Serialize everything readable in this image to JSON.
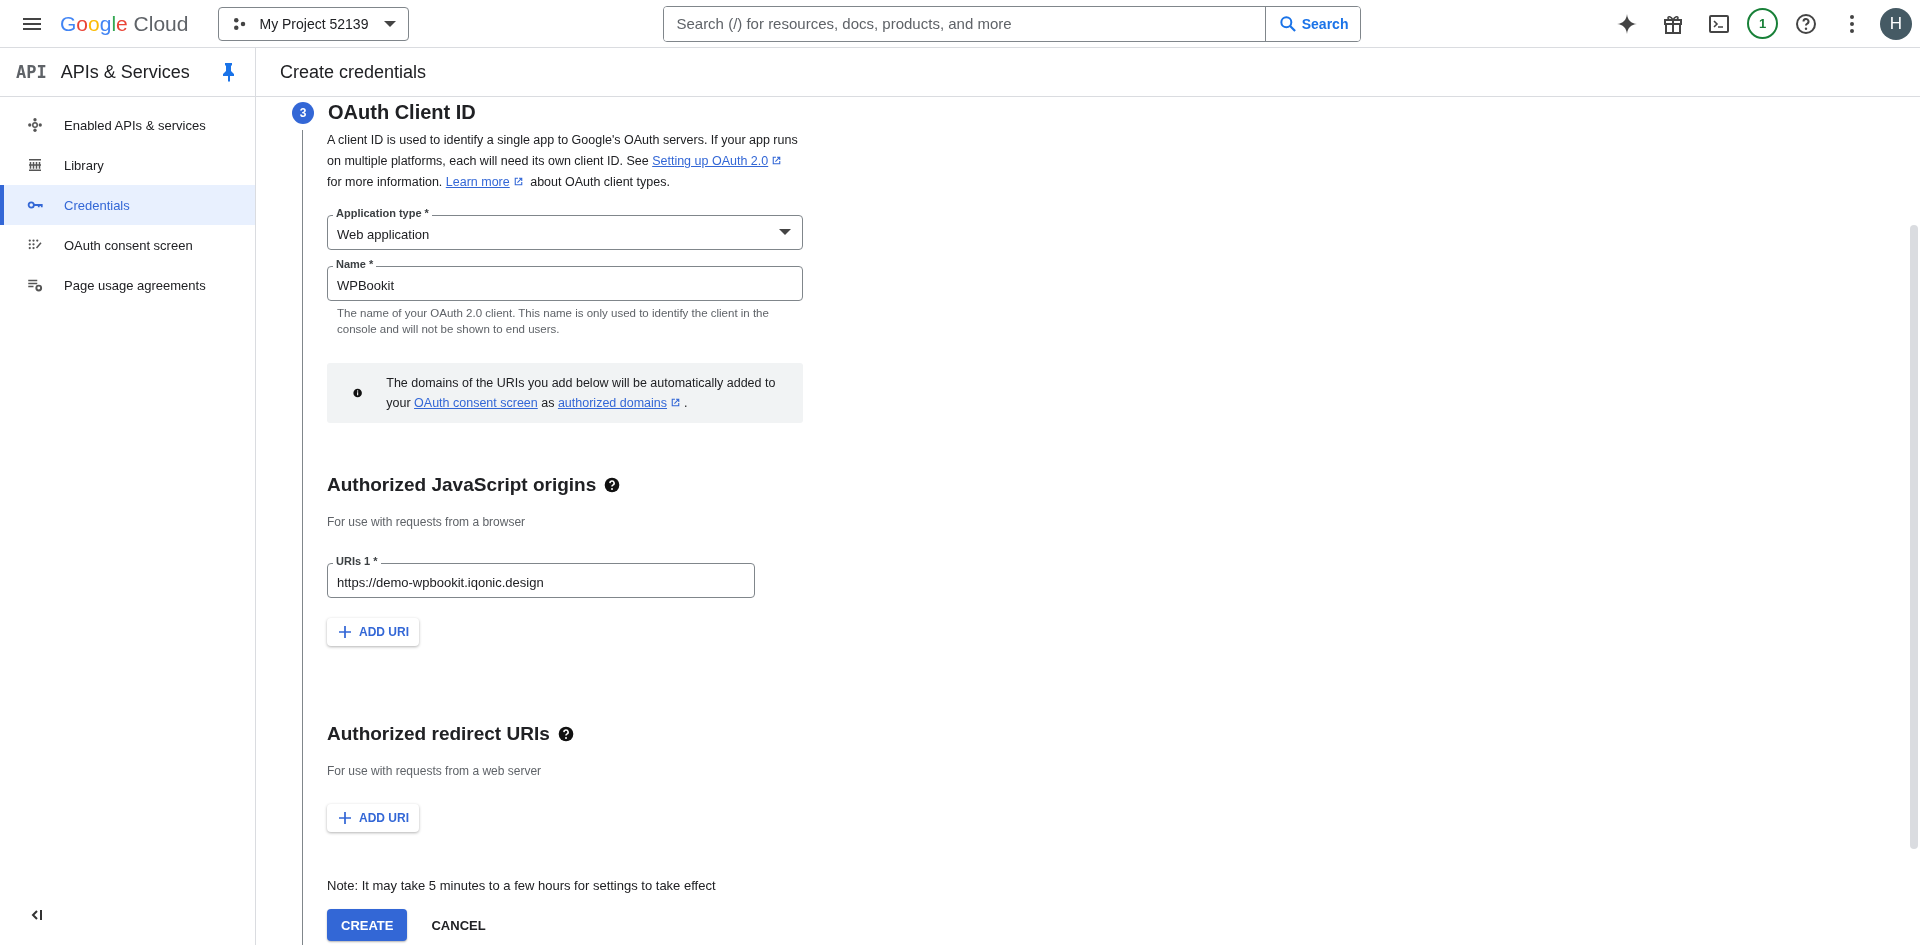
{
  "topbar": {
    "logo": "Google Cloud",
    "project": "My Project 52139",
    "search": {
      "placeholder": "Search (/) for resources, docs, products, and more",
      "button": "Search"
    },
    "notifications": "1",
    "avatar": "H"
  },
  "sidebar": {
    "badge": "API",
    "title": "APIs & Services",
    "pinned": true,
    "items": [
      {
        "label": "Enabled APIs & services",
        "selected": false
      },
      {
        "label": "Library",
        "selected": false
      },
      {
        "label": "Credentials",
        "selected": true
      },
      {
        "label": "OAuth consent screen",
        "selected": false
      },
      {
        "label": "Page usage agreements",
        "selected": false
      }
    ]
  },
  "page": {
    "title": "Create credentials"
  },
  "step": {
    "number": "3",
    "title": "OAuth Client ID",
    "description": [
      {
        "kind": "text",
        "text": "A client ID is used to identify a single app to Google's OAuth servers. If your app runs on multiple platforms, each will need its own client ID. See "
      },
      {
        "kind": "external_link",
        "text": "Setting up OAuth 2.0"
      },
      {
        "kind": "text",
        "text": " for more information. "
      },
      {
        "kind": "external_link",
        "text": "Learn more"
      },
      {
        "kind": "text",
        "text": " about OAuth client types."
      }
    ],
    "fields": [
      {
        "kind": "select",
        "label": "Application type *",
        "value": "Web application"
      },
      {
        "kind": "text",
        "label": "Name *",
        "value": "WPBookit",
        "helper": "The name of your OAuth 2.0 client. This name is only used to identify the client in the console and will not be shown to end users."
      }
    ],
    "info": [
      {
        "kind": "text",
        "text": "The domains of the URIs you add below will be automatically added to your "
      },
      {
        "kind": "link",
        "text": "OAuth consent screen"
      },
      {
        "kind": "text",
        "text": " as "
      },
      {
        "kind": "external_link",
        "text": "authorized domains"
      },
      {
        "kind": "text",
        "text": "."
      }
    ],
    "sections": [
      {
        "title": "Authorized JavaScript origins",
        "subtitle": "For use with requests from a browser",
        "uris": [
          {
            "label": "URIs 1 *",
            "value": "https://demo-wpbookit.iqonic.design"
          }
        ],
        "add_button": "ADD URI"
      },
      {
        "title": "Authorized redirect URIs",
        "subtitle": "For use with requests from a web server",
        "add_button": "ADD URI"
      }
    ],
    "note": "Note: It may take 5 minutes to a few hours for settings to take effect",
    "buttons": [
      {
        "kind": "primary",
        "label": "CREATE"
      },
      {
        "kind": "text",
        "label": "CANCEL"
      }
    ]
  }
}
